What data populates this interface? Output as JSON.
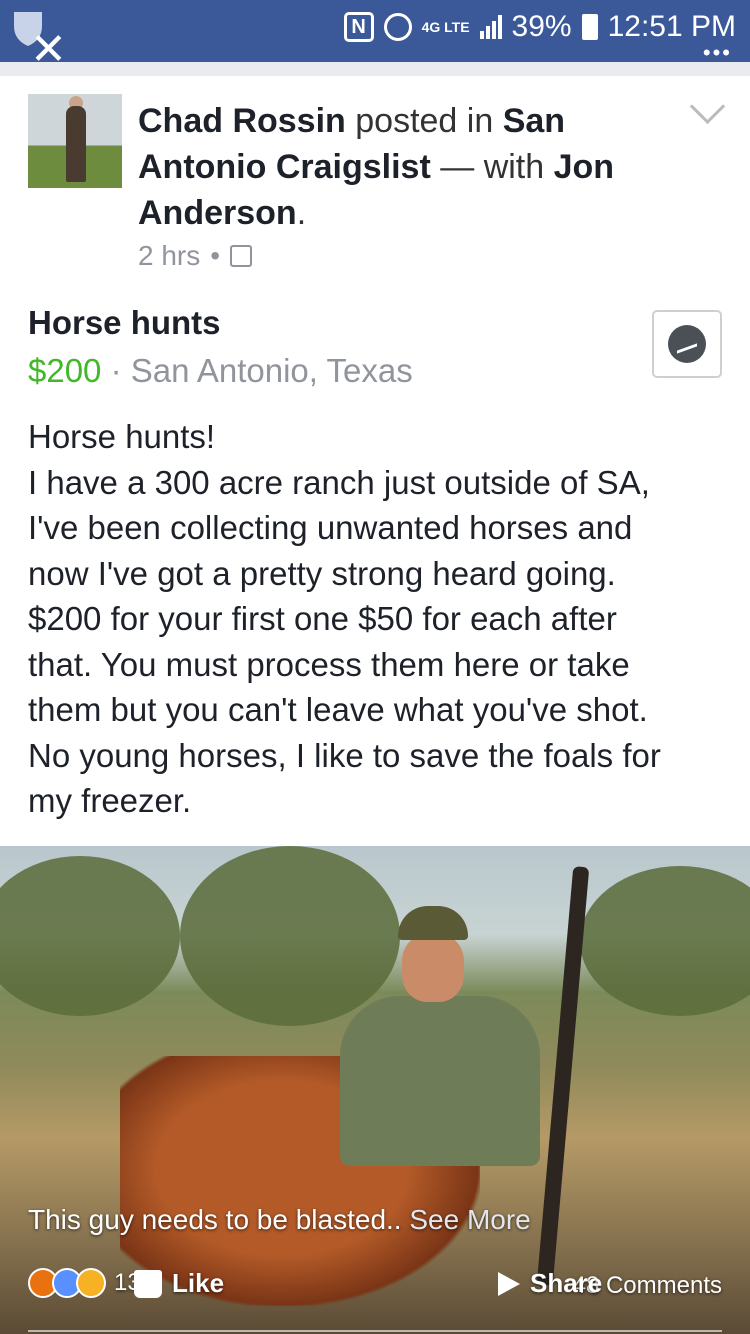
{
  "status_bar": {
    "battery": "39%",
    "time": "12:51 PM",
    "network": "4G LTE",
    "nfc_label": "N",
    "close_glyph": "✕",
    "menu_glyph": "•••"
  },
  "post": {
    "author": "Chad Rossin",
    "posted_in_text": " posted in ",
    "group": "San Antonio Craigslist",
    "with_text": " — with ",
    "tagged": "Jon Anderson",
    "period": ".",
    "time": "2 hrs",
    "dot": "•",
    "listing": {
      "title": "Horse hunts",
      "price": "$200",
      "location": "San Antonio, Texas"
    },
    "body_lines": [
      "Horse hunts!",
      "I have a 300 acre ranch just outside of SA,",
      "I've been collecting unwanted horses and",
      "now I've got a pretty strong heard going.",
      "$200 for your first one $50 for each after",
      "that. You must process them here or take",
      "them but you can't leave what you've shot.",
      "No young horses, I like to save the foals for",
      "my freezer."
    ],
    "share_caption": "This guy needs to be blasted..",
    "see_more": " See More",
    "reaction_count": "130",
    "comments": "48 Comments",
    "like_label": "Like",
    "share_label": "Share"
  }
}
